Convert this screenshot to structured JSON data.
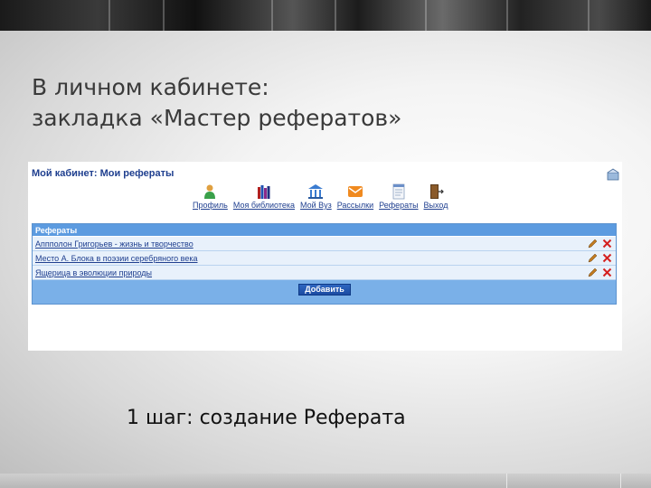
{
  "slide": {
    "title_line1": "В личном кабинете:",
    "title_line2": "закладка «Мастер рефератов»",
    "caption": "1 шаг: создание Реферата"
  },
  "cabinet": {
    "title": "Мой кабинет: Мои рефераты",
    "toolbar": [
      {
        "label": "Профиль",
        "icon": "profile-icon"
      },
      {
        "label": "Моя библиотека",
        "icon": "library-icon"
      },
      {
        "label": "Мой Вуз",
        "icon": "university-icon"
      },
      {
        "label": "Рассылки",
        "icon": "mail-icon"
      },
      {
        "label": "Рефераты",
        "icon": "document-icon"
      },
      {
        "label": "Выход",
        "icon": "exit-door-icon"
      }
    ],
    "grid": {
      "header": "Рефераты",
      "rows": [
        {
          "title": "Аппполон Григорьев - жизнь и творчество"
        },
        {
          "title": "Место А. Блока в поэзии серебряного века"
        },
        {
          "title": "Ящерица в эволюции природы"
        }
      ],
      "add_label": "Добавить"
    }
  },
  "colors": {
    "link": "#1f3f8f",
    "grid_header": "#5c9be0",
    "grid_bg": "#7ab0e8",
    "row_bg": "#e8f1fb",
    "delete": "#d42020",
    "edit": "#c07a20"
  }
}
